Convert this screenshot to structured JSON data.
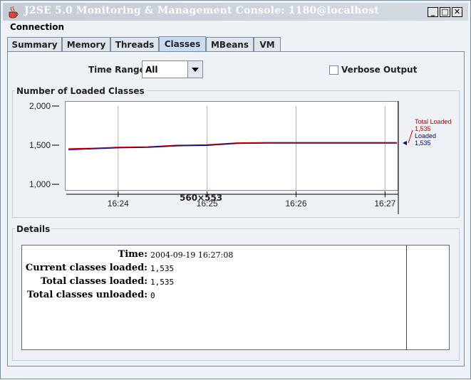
{
  "window": {
    "title": "J2SE 5.0 Monitoring & Management Console: 1180@localhost"
  },
  "menu": {
    "connection": "Connection"
  },
  "tabs": [
    {
      "label": "Summary"
    },
    {
      "label": "Memory"
    },
    {
      "label": "Threads"
    },
    {
      "label": "Classes"
    },
    {
      "label": "MBeans"
    },
    {
      "label": "VM"
    }
  ],
  "controls": {
    "time_range_label": "Time Range:",
    "time_range_value": "All",
    "verbose_label": "Verbose Output"
  },
  "chart_section": {
    "title": "Number of Loaded Classes"
  },
  "chart_data": {
    "type": "line",
    "x": [
      "16:23:20",
      "16:23:40",
      "16:24:00",
      "16:24:20",
      "16:24:40",
      "16:25:00",
      "16:25:20",
      "16:25:40",
      "16:26:00",
      "16:26:20",
      "16:26:40",
      "16:27:00",
      "16:27:08"
    ],
    "x_tick_labels": [
      "16:24",
      "16:25",
      "16:26",
      "16:27"
    ],
    "y_tick_labels": [
      "2,000",
      "1,500",
      "1,000"
    ],
    "ylim": [
      1000,
      2000
    ],
    "series": [
      {
        "name": "Total Loaded",
        "color": "#cc0000",
        "values": [
          1455,
          1460,
          1475,
          1480,
          1500,
          1505,
          1530,
          1535,
          1535,
          1535,
          1535,
          1535,
          1535
        ]
      },
      {
        "name": "Loaded",
        "color": "#000080",
        "values": [
          1450,
          1460,
          1475,
          1480,
          1500,
          1505,
          1530,
          1535,
          1535,
          1535,
          1535,
          1535,
          1535
        ]
      }
    ],
    "legend": [
      {
        "name": "Total Loaded",
        "value": "1,535",
        "color": "#cc0000"
      },
      {
        "name": "Loaded",
        "value": "1,535",
        "color": "#000080"
      }
    ]
  },
  "overlay_text": "560×553",
  "details": {
    "title": "Details",
    "rows": [
      {
        "label": "Time:",
        "value": "2004-09-19 16:27:08"
      },
      {
        "label": "Current classes loaded:",
        "value": "1,535"
      },
      {
        "label": "Total classes loaded:",
        "value": "1,535"
      },
      {
        "label": "Total classes unloaded:",
        "value": "0"
      }
    ]
  }
}
